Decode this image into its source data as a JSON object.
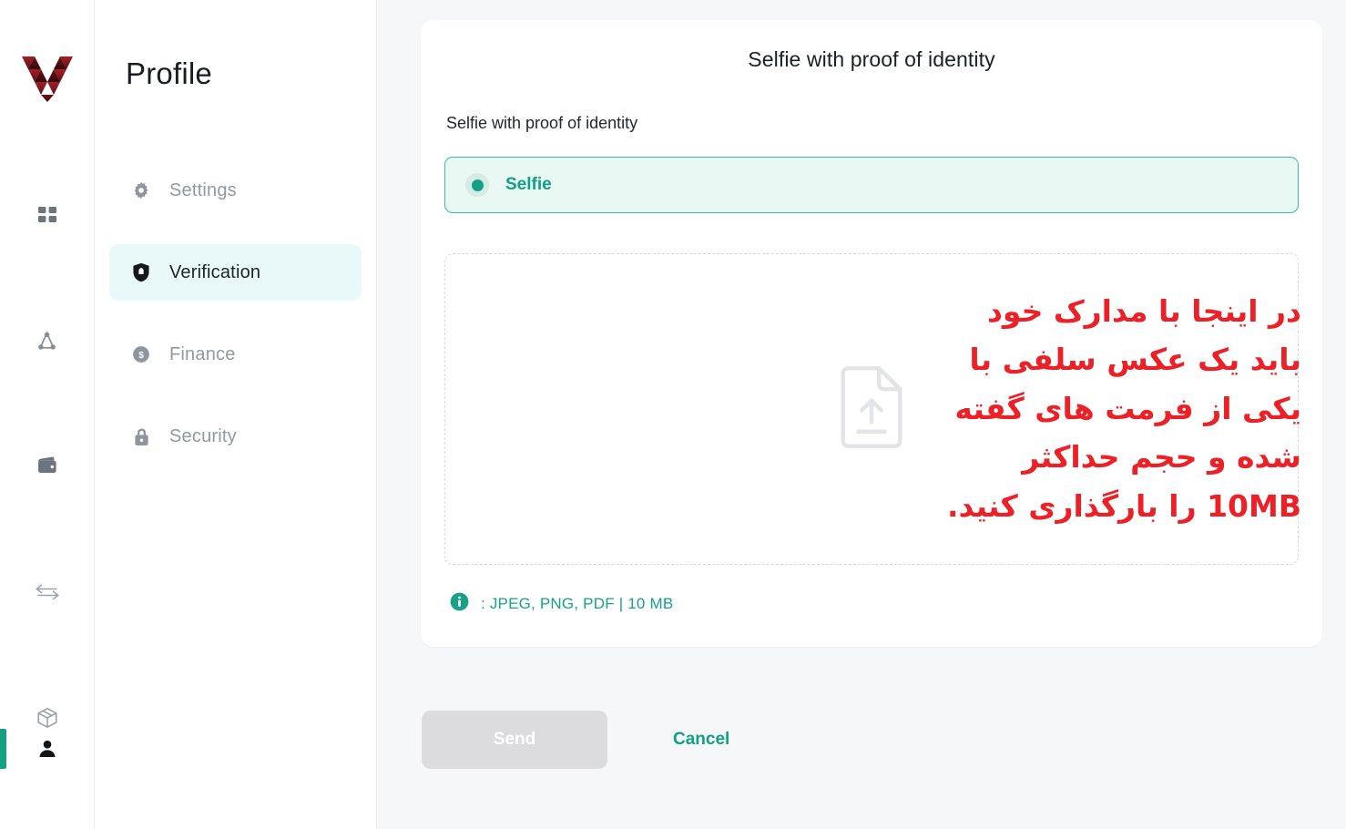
{
  "colors": {
    "accent": "#12a084",
    "accent_soft": "#e9f8f3",
    "active_nav": "#e9f9f9",
    "annotation_red": "#ec2027",
    "logo_red": "#8e1b1f",
    "muted": "#93999f",
    "page_bg": "#f6f7f8"
  },
  "rail": {
    "logo_name": "vex-logo",
    "items": [
      {
        "icon": "grid-dashboard-icon",
        "name": "rail-item-dashboard"
      },
      {
        "icon": "network-nodes-icon",
        "name": "rail-item-network"
      },
      {
        "icon": "wallet-icon",
        "name": "rail-item-wallet"
      },
      {
        "icon": "exchange-arrows-icon",
        "name": "rail-item-exchange"
      },
      {
        "icon": "box-cube-icon",
        "name": "rail-item-products"
      }
    ],
    "bottom_item": {
      "icon": "user-profile-icon",
      "name": "rail-item-profile",
      "active": true
    }
  },
  "sidebar": {
    "title": "Profile",
    "items": [
      {
        "label": "Settings",
        "icon": "gear-icon",
        "active": false
      },
      {
        "label": "Verification",
        "icon": "shield-icon",
        "active": true
      },
      {
        "label": "Finance",
        "icon": "dollar-circle-icon",
        "active": false
      },
      {
        "label": "Security",
        "icon": "lock-icon",
        "active": false
      }
    ]
  },
  "main": {
    "card_title": "Selfie with proof of identity",
    "field_label": "Selfie with proof of identity",
    "option": {
      "label": "Selfie",
      "selected": true
    },
    "dropzone": {
      "icon": "file-upload-icon",
      "annotation_text": "در اینجا با مدارک خود باید یک عکس سلفی با یکی از فرمت های گفته شده و حجم حداکثر 10MB را بارگذاری کنید."
    },
    "hint": {
      "icon": "info-icon",
      "text": ": JPEG, PNG, PDF | 10 MB"
    },
    "actions": {
      "send_label": "Send",
      "send_disabled": true,
      "cancel_label": "Cancel"
    }
  }
}
